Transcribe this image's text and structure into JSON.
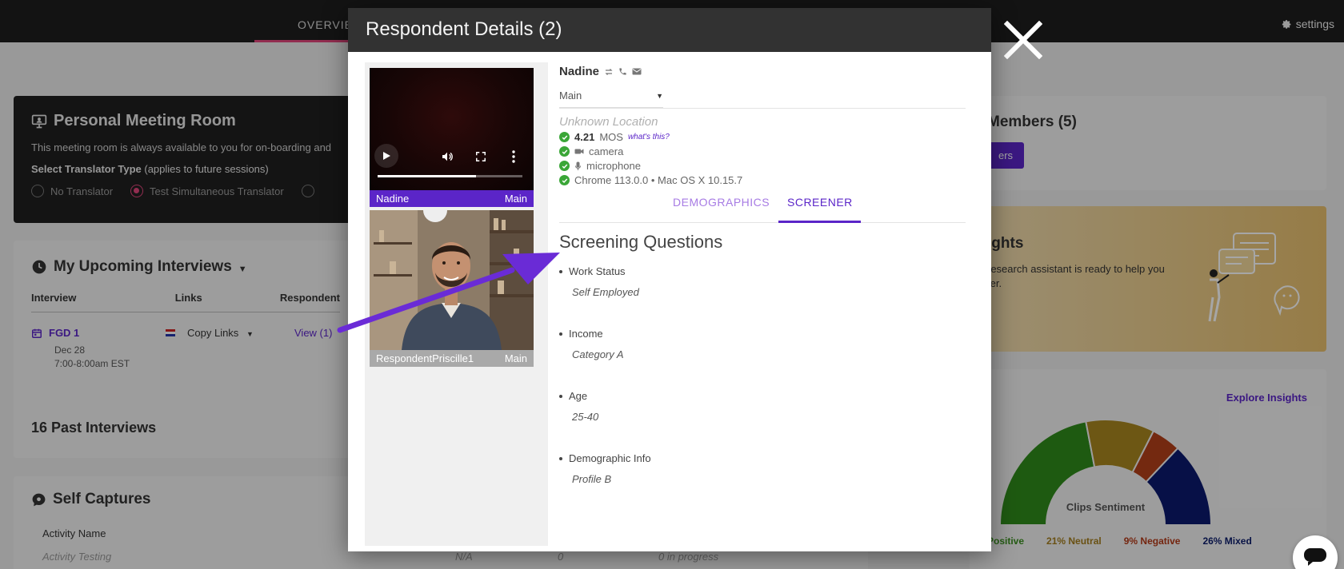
{
  "topbar": {
    "tab_overview": "OVERVIEW",
    "settings_label": "settings"
  },
  "pmr": {
    "title": "Personal Meeting Room",
    "description": "This meeting room is always available to you for on-boarding and",
    "translator_label_bold": "Select Translator Type",
    "translator_label_rest": " (applies to future sessions)",
    "options": [
      "No Translator",
      "Test Simultaneous Translator",
      ""
    ],
    "selected_option": "Test Simultaneous Translator"
  },
  "upcoming": {
    "title": "My Upcoming Interviews",
    "columns": [
      "Interview",
      "Links",
      "Respondent"
    ],
    "row": {
      "name": "FGD 1",
      "date": "Dec 28",
      "time": "7:00-8:00am EST",
      "links": "Copy Links",
      "respondents": "View (1)"
    },
    "past": "16 Past Interviews"
  },
  "selfcaptures": {
    "title": "Self Captures",
    "header": "Activity Name",
    "row": {
      "name": "Activity Testing",
      "col2": "N/A",
      "col3": "0",
      "col4": "0 in progress"
    }
  },
  "members": {
    "title": "Members (5)",
    "button": "ers"
  },
  "insights": {
    "title": "ights",
    "description_line1": "research assistant is ready to help you",
    "description_line2": "ter."
  },
  "sentiment": {
    "explore": "Explore Insights",
    "center_label": "Clips Sentiment",
    "legend": [
      {
        "label": "Positive",
        "color": "#3a8e1f"
      },
      {
        "label": "21% Neutral",
        "color": "#a37d1e"
      },
      {
        "label": "9% Negative",
        "color": "#b33a18"
      },
      {
        "label": "26% Mixed",
        "color": "#0c1c6b"
      }
    ]
  },
  "chart_data": {
    "type": "pie",
    "title": "Clips Sentiment",
    "categories": [
      "Positive",
      "Neutral",
      "Negative",
      "Mixed"
    ],
    "values": [
      44,
      21,
      9,
      26
    ],
    "colors": [
      "#2f8a1b",
      "#a8861f",
      "#b3401a",
      "#0b1a6e"
    ],
    "style": "half-donut"
  },
  "modal": {
    "title": "Respondent Details (2)",
    "tiles": [
      {
        "name": "Nadine",
        "room": "Main"
      },
      {
        "name": "RespondentPriscille1",
        "room": "Main"
      }
    ],
    "video_progress": 0.68,
    "respondent": {
      "name": "Nadine",
      "room_select": "Main",
      "location": "Unknown Location",
      "mos_value": "4.21",
      "mos_label": "MOS",
      "whats_this": "what's this?",
      "camera": "camera",
      "microphone": "microphone",
      "browser": "Chrome 113.0.0 • Mac OS X 10.15.7"
    },
    "tabs": {
      "demographics": "DEMOGRAPHICS",
      "screener": "SCREENER",
      "active": "SCREENER"
    },
    "screener": {
      "title": "Screening Questions",
      "questions": [
        {
          "q": "Work Status",
          "a": "Self Employed"
        },
        {
          "q": "Income",
          "a": "Category A"
        },
        {
          "q": "Age",
          "a": "25-40"
        },
        {
          "q": "Demographic Info",
          "a": "Profile B"
        }
      ]
    }
  },
  "colors": {
    "accent": "#5b25c8",
    "pink": "#e0457b",
    "check": "#3aa637",
    "arrow": "#6a2bd6"
  }
}
